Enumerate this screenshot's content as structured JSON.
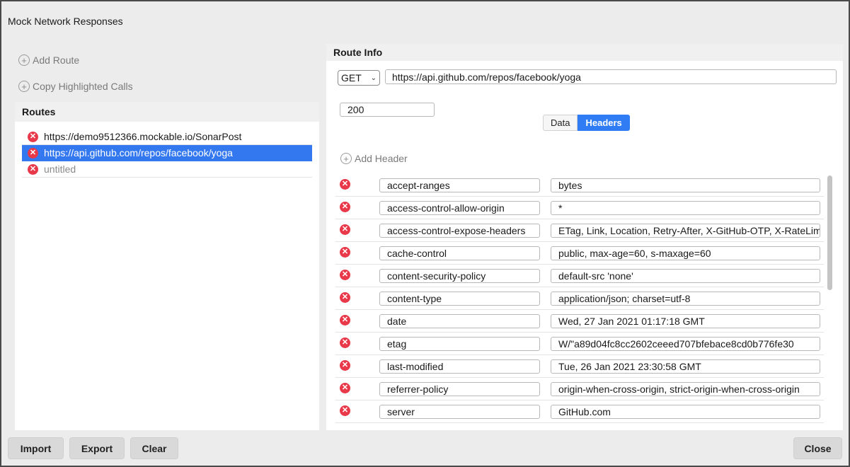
{
  "dialog": {
    "title": "Mock Network Responses"
  },
  "actions": {
    "add_route": "Add Route",
    "copy_highlighted": "Copy Highlighted Calls"
  },
  "routes": {
    "header": "Routes",
    "items": [
      {
        "label": "https://demo9512366.mockable.io/SonarPost",
        "selected": false
      },
      {
        "label": "https://api.github.com/repos/facebook/yoga",
        "selected": true
      },
      {
        "label": "untitled",
        "selected": false
      }
    ]
  },
  "route_info": {
    "header": "Route Info",
    "method": "GET",
    "url": "https://api.github.com/repos/facebook/yoga",
    "status": "200",
    "tabs": [
      {
        "label": "Data",
        "active": false
      },
      {
        "label": "Headers",
        "active": true
      }
    ],
    "add_header": "Add Header",
    "headers": [
      {
        "key": "accept-ranges",
        "value": "bytes"
      },
      {
        "key": "access-control-allow-origin",
        "value": "*"
      },
      {
        "key": "access-control-expose-headers",
        "value": "ETag, Link, Location, Retry-After, X-GitHub-OTP, X-RateLimit-Limit"
      },
      {
        "key": "cache-control",
        "value": "public, max-age=60, s-maxage=60"
      },
      {
        "key": "content-security-policy",
        "value": "default-src 'none'"
      },
      {
        "key": "content-type",
        "value": "application/json; charset=utf-8"
      },
      {
        "key": "date",
        "value": "Wed, 27 Jan 2021 01:17:18 GMT"
      },
      {
        "key": "etag",
        "value": "W/\"a89d04fc8cc2602ceeed707bfebace8cd0b776fe30"
      },
      {
        "key": "last-modified",
        "value": "Tue, 26 Jan 2021 23:30:58 GMT"
      },
      {
        "key": "referrer-policy",
        "value": "origin-when-cross-origin, strict-origin-when-cross-origin"
      },
      {
        "key": "server",
        "value": "GitHub.com"
      }
    ]
  },
  "buttons": {
    "import": "Import",
    "export": "Export",
    "clear": "Clear",
    "close": "Close"
  },
  "colors": {
    "selection": "#3478f0",
    "tab_active": "#2f7cf5",
    "delete": "#e8394a"
  }
}
